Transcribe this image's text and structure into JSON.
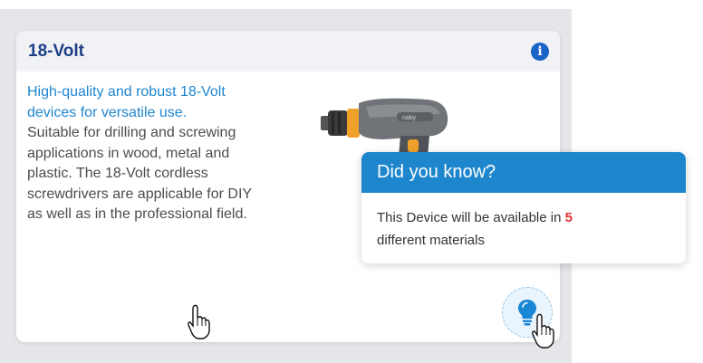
{
  "card": {
    "title": "18-Volt",
    "info_icon": "info-icon",
    "description_highlight": "High-quality and robust 18-Volt devices for versatile use.",
    "description_body": "Suitable for drilling and screwing applications in wood, metal and plastic. The 18-Volt cordless screwdrivers are applicable for DIY as well as in the professional field.",
    "image": "cordless-drill-image",
    "drill_brand": "naby"
  },
  "tooltip": {
    "title": "Did you know?",
    "text_before": "This Device will be available in",
    "count": "5",
    "text_after": "different materials"
  },
  "bulb_button": {
    "icon": "lightbulb-icon"
  },
  "colors": {
    "title": "#1d3f86",
    "highlight": "#1f86cf",
    "tooltip_header": "#1e86cc",
    "count": "#e0322f",
    "panel_bg": "#e5e6ea"
  }
}
